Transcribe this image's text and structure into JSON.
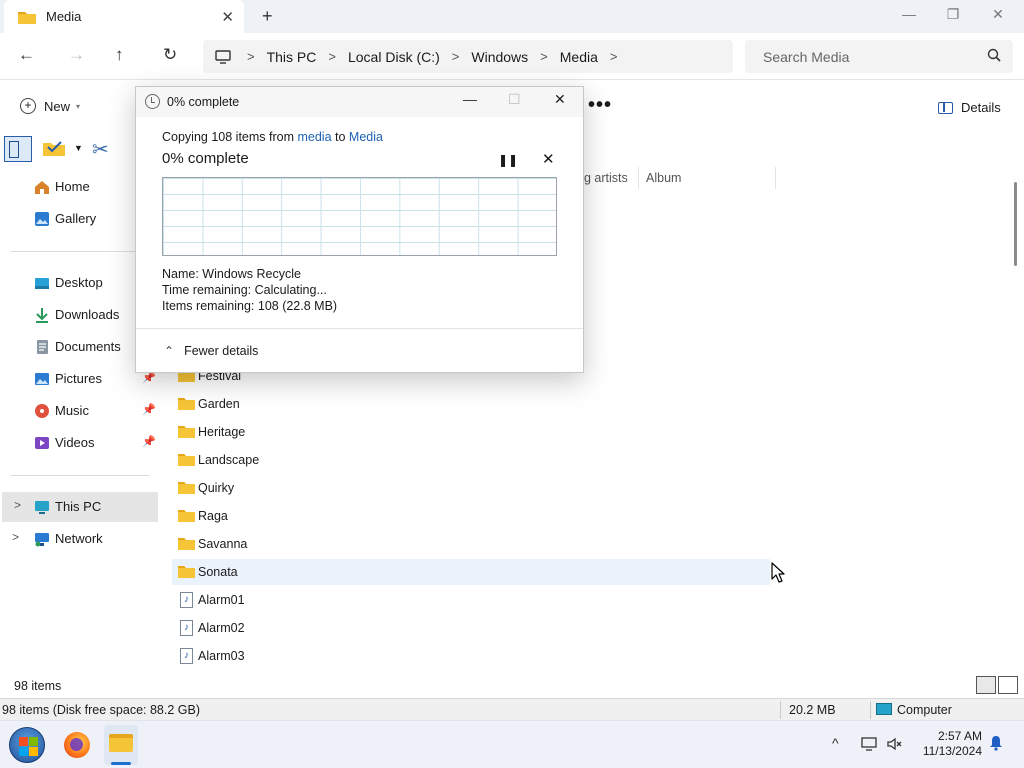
{
  "window": {
    "tab_title": "Media",
    "tab_close": "✕",
    "new_tab": "+",
    "minimize": "—",
    "maximize": "❐",
    "close": "✕"
  },
  "address": {
    "back": "←",
    "forward": "→",
    "up": "↑",
    "refresh": "↻",
    "crumbs": [
      "This PC",
      "Local Disk (C:)",
      "Windows",
      "Media"
    ],
    "search_placeholder": "Search Media"
  },
  "commandbar": {
    "new_label": "New",
    "more": "•••",
    "details_label": "Details"
  },
  "nav": {
    "items": [
      {
        "label": "Home",
        "icon": "home-icon",
        "color": "#d9822b"
      },
      {
        "label": "Gallery",
        "icon": "gallery-icon",
        "color": "#2b7bd0"
      },
      {
        "label": "Desktop",
        "icon": "desktop-icon",
        "color": "#26a0d6"
      },
      {
        "label": "Downloads",
        "icon": "download-icon",
        "color": "#2a9a5a"
      },
      {
        "label": "Documents",
        "icon": "documents-icon",
        "color": "#7b8794"
      },
      {
        "label": "Pictures",
        "icon": "pictures-icon",
        "color": "#2b7bd0"
      },
      {
        "label": "Music",
        "icon": "music-icon",
        "color": "#e0523d"
      },
      {
        "label": "Videos",
        "icon": "videos-icon",
        "color": "#7b45c4"
      },
      {
        "label": "This PC",
        "icon": "this-pc-icon",
        "color": "#25a3c9"
      },
      {
        "label": "Network",
        "icon": "network-icon",
        "color": "#2b7bd0"
      }
    ],
    "pin": "📌"
  },
  "columns": {
    "contributing_artists": "ng artists",
    "album": "Album"
  },
  "files": [
    {
      "name": "Festival",
      "type": "folder"
    },
    {
      "name": "Garden",
      "type": "folder"
    },
    {
      "name": "Heritage",
      "type": "folder"
    },
    {
      "name": "Landscape",
      "type": "folder"
    },
    {
      "name": "Quirky",
      "type": "folder"
    },
    {
      "name": "Raga",
      "type": "folder"
    },
    {
      "name": "Savanna",
      "type": "folder"
    },
    {
      "name": "Sonata",
      "type": "folder",
      "highlighted": true
    },
    {
      "name": "Alarm01",
      "type": "audio"
    },
    {
      "name": "Alarm02",
      "type": "audio"
    },
    {
      "name": "Alarm03",
      "type": "audio"
    }
  ],
  "status": {
    "item_count": "98 items",
    "classic_left": "98 items (Disk free space: 88.2 GB)",
    "classic_size": "20.2 MB",
    "classic_location": "Computer"
  },
  "taskbar": {
    "time": "2:57 AM",
    "date": "11/13/2024",
    "tray_up": "^"
  },
  "dialog": {
    "title": "0% complete",
    "copying_prefix": "Copying 108 items from ",
    "source": "media",
    "to_word": " to ",
    "destination": "Media",
    "progress_label": "0% complete",
    "progress_percent": 0,
    "pause": "❚❚",
    "stop": "✕",
    "name_line": "Name:  Windows Recycle",
    "time_line": "Time remaining:  Calculating...",
    "items_line": "Items remaining:  108 (22.8 MB)",
    "fewer_details": "Fewer details",
    "minimize": "—",
    "maximize": "☐",
    "close": "✕"
  },
  "colors": {
    "accent": "#1e62b4",
    "folder": "#f6c437",
    "selection": "#eaf3fc"
  }
}
